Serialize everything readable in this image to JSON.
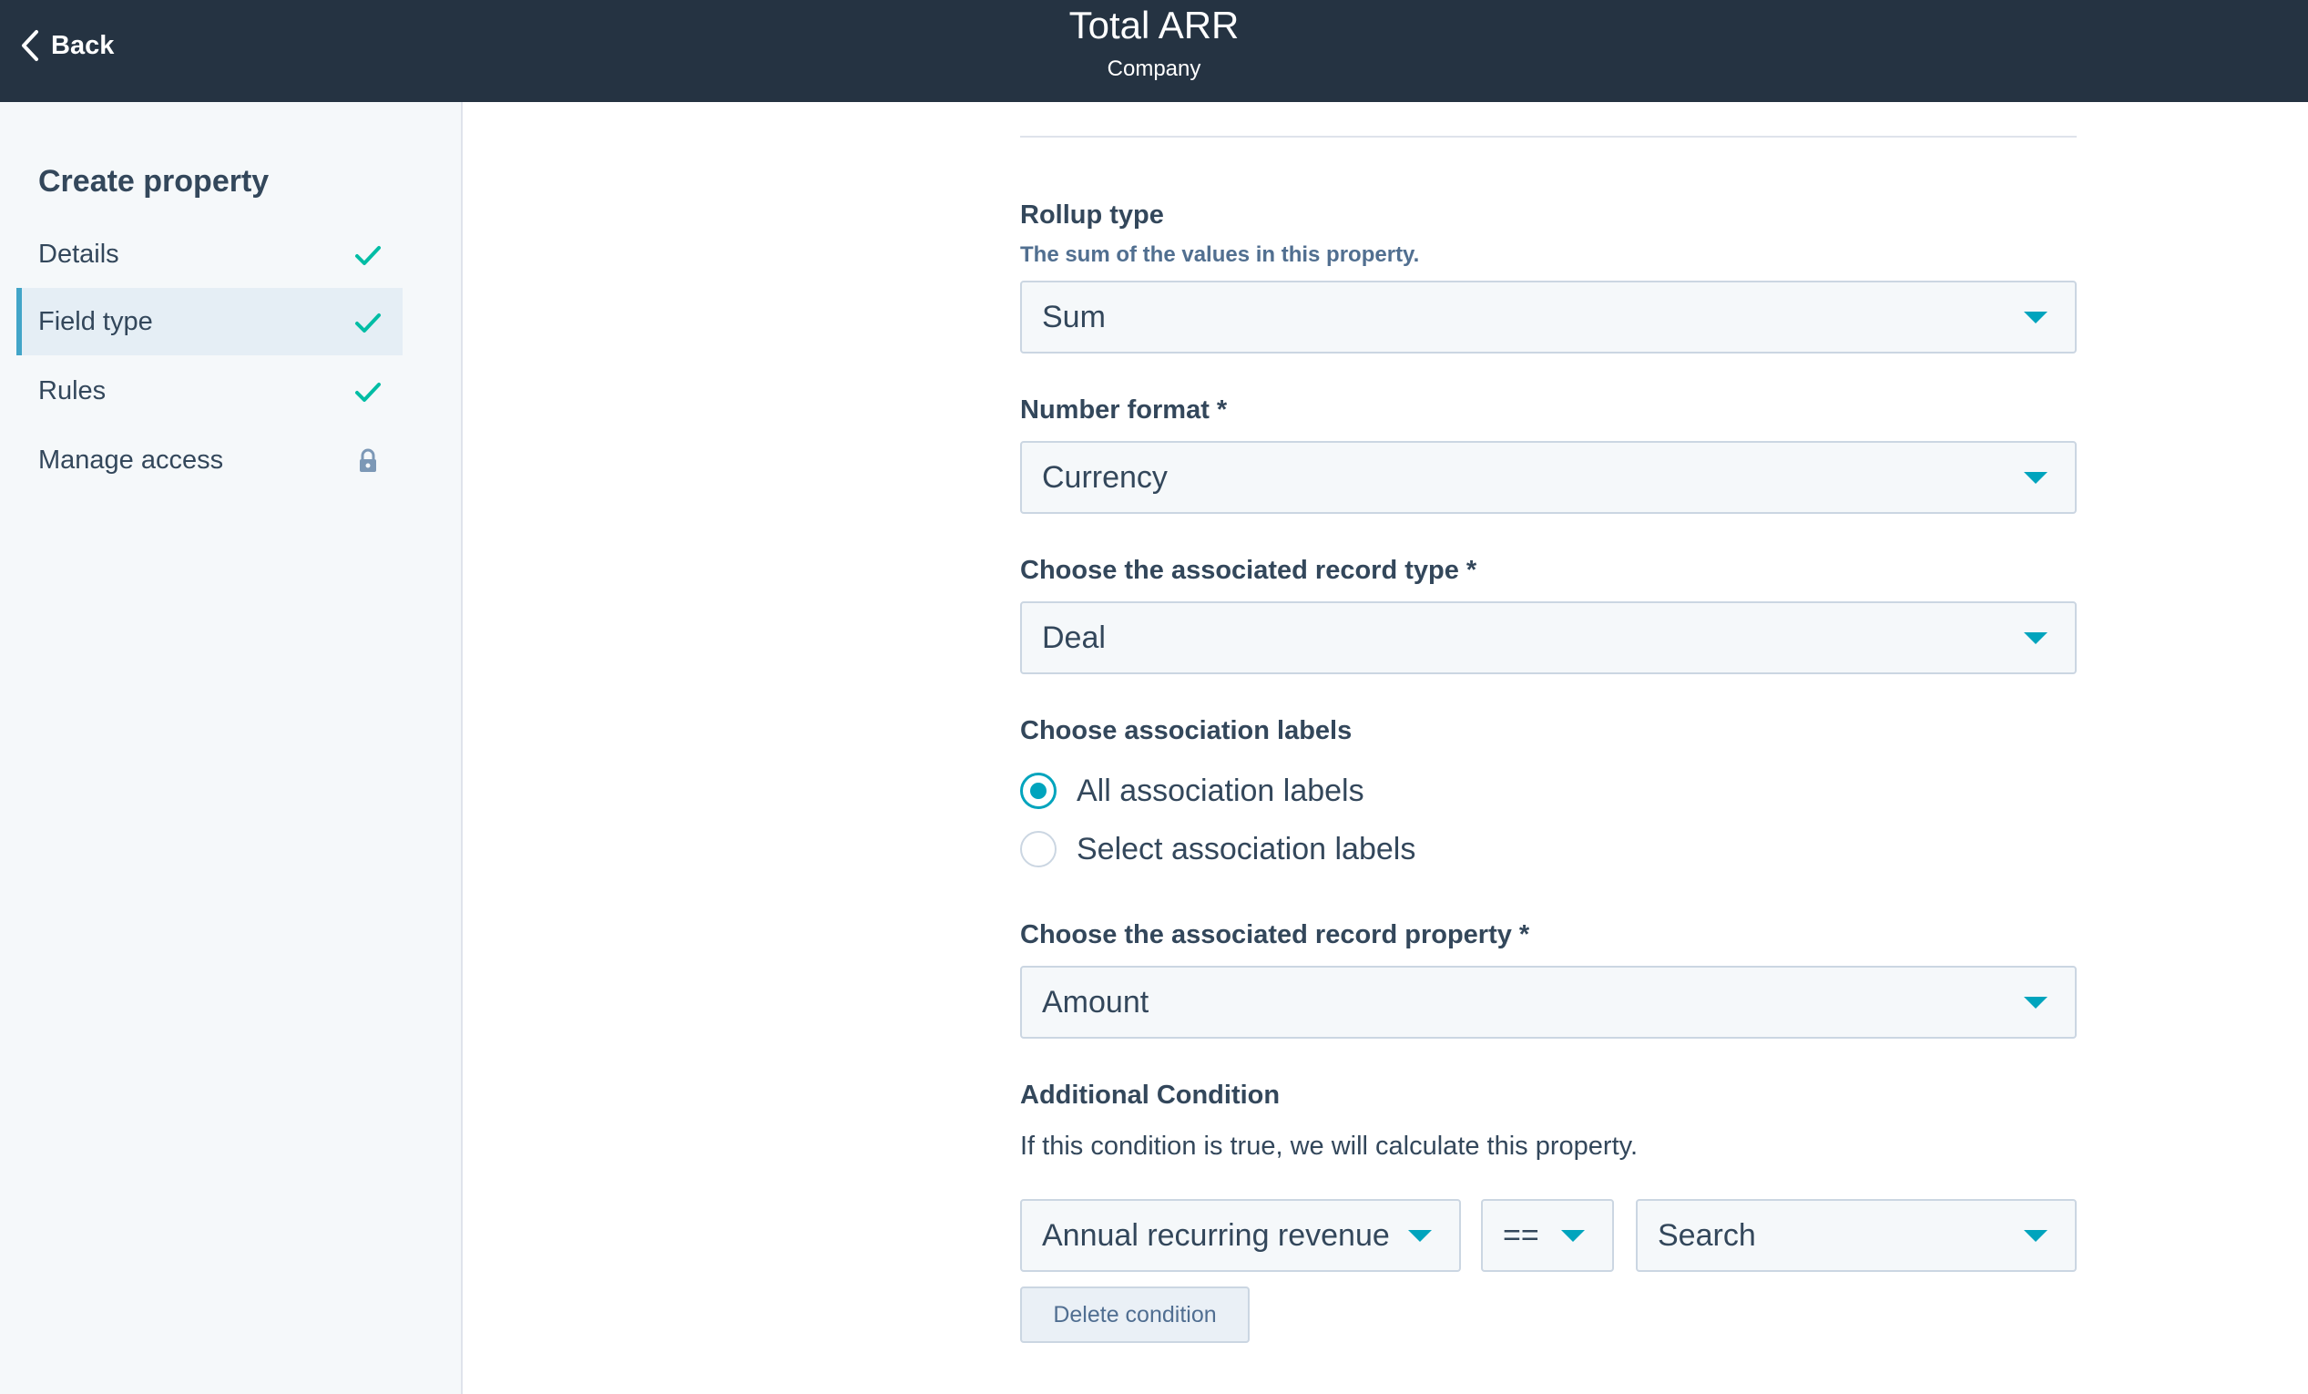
{
  "header": {
    "back_label": "Back",
    "title": "Total ARR",
    "subtitle": "Company"
  },
  "sidebar": {
    "heading": "Create property",
    "items": [
      {
        "label": "Details",
        "status": "complete"
      },
      {
        "label": "Field type",
        "status": "complete",
        "active": true
      },
      {
        "label": "Rules",
        "status": "complete"
      },
      {
        "label": "Manage access",
        "status": "locked"
      }
    ]
  },
  "form": {
    "rollup_type": {
      "label": "Rollup type",
      "help": "The sum of the values in this property.",
      "value": "Sum"
    },
    "number_format": {
      "label": "Number format *",
      "value": "Currency"
    },
    "record_type": {
      "label": "Choose the associated record type *",
      "value": "Deal"
    },
    "association_labels": {
      "label": "Choose association labels",
      "options": [
        {
          "label": "All association labels",
          "selected": true
        },
        {
          "label": "Select association labels",
          "selected": false
        }
      ]
    },
    "record_property": {
      "label": "Choose the associated record property *",
      "value": "Amount"
    },
    "condition": {
      "label": "Additional Condition",
      "description": "If this condition is true, we will calculate this property.",
      "property_value": "Annual recurring revenue",
      "operator_value": "==",
      "search_value": "Search",
      "delete_label": "Delete condition"
    }
  },
  "colors": {
    "header_bg": "#253342",
    "accent": "#00a4bd",
    "check": "#00bda5",
    "text": "#33475b"
  }
}
